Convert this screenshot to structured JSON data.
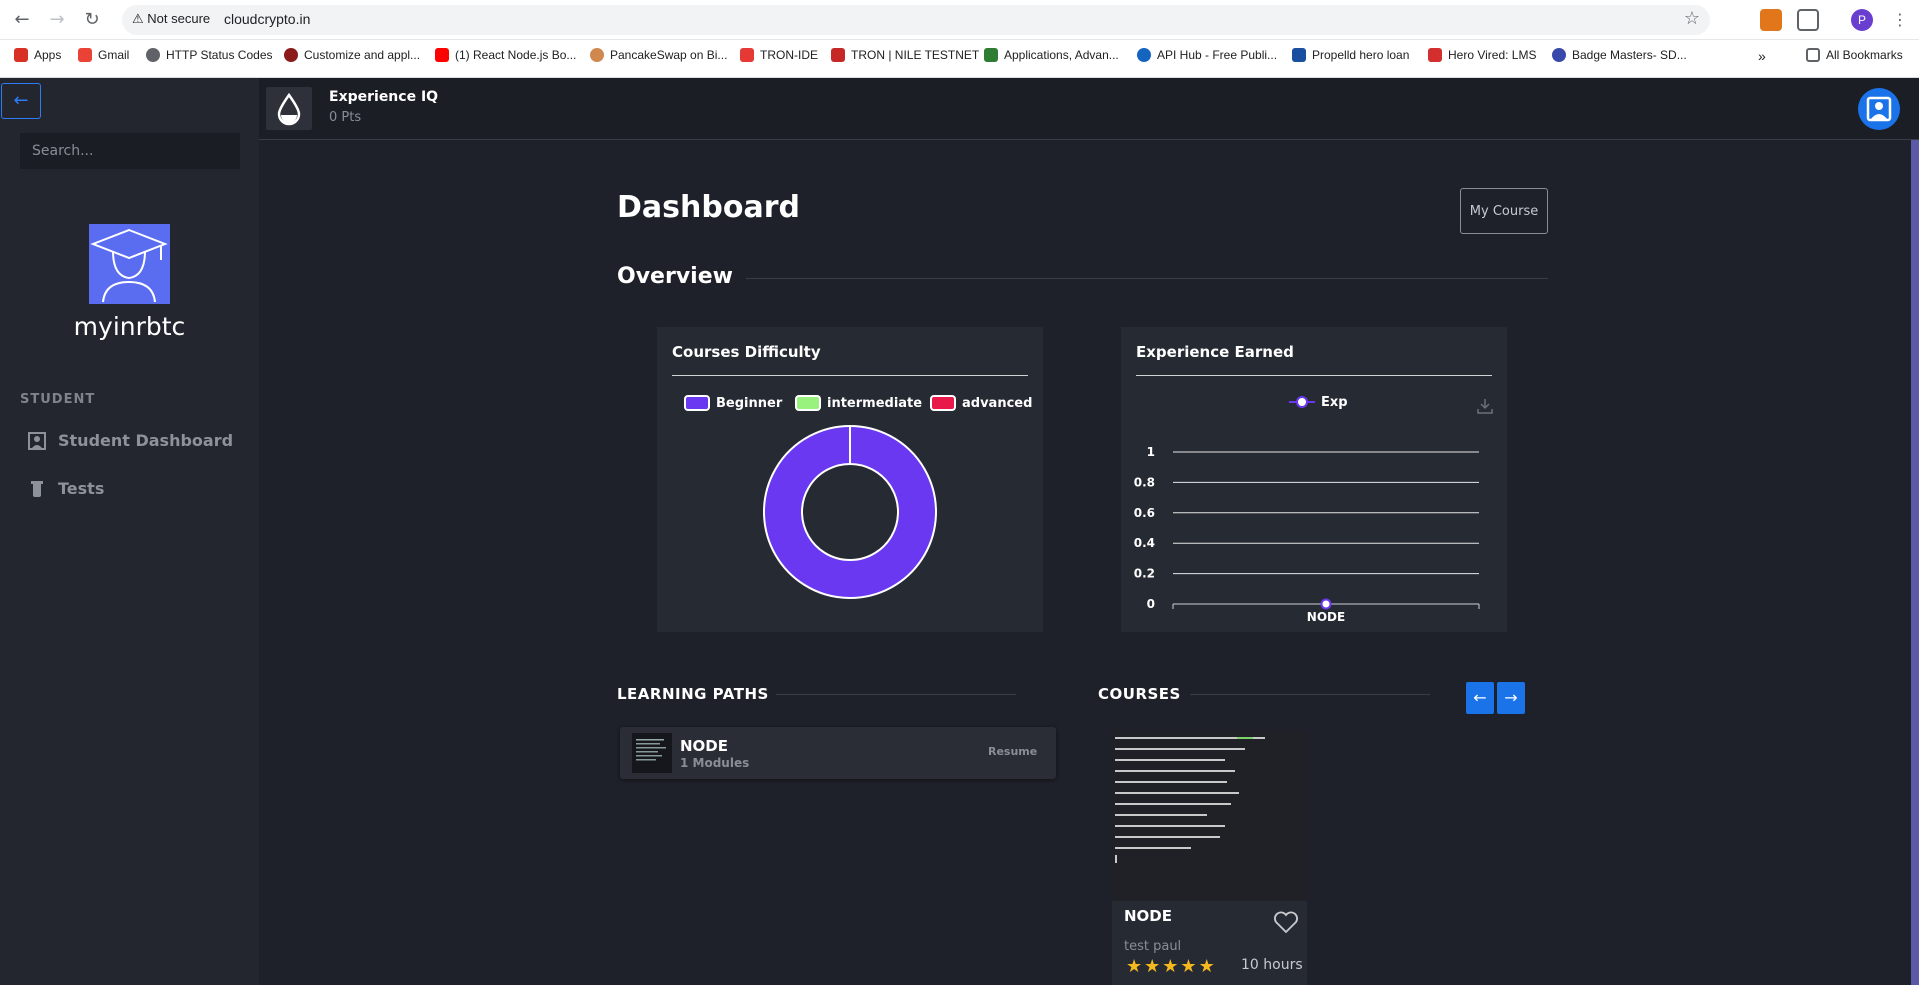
{
  "browser": {
    "not_secure": "Not secure",
    "url": "cloudcrypto.in",
    "profile_initial": "P",
    "all_bookmarks": "All Bookmarks",
    "bookmarks": [
      "Apps",
      "Gmail",
      "HTTP Status Codes",
      "Customize and appl...",
      "(1) React Node.js Bo...",
      "PancakeSwap on Bi...",
      "TRON-IDE",
      "TRON | NILE TESTNET",
      "Applications, Advan...",
      "API Hub - Free Publi...",
      "Propelld hero loan",
      "Hero Vired: LMS",
      "Badge Masters- SD..."
    ]
  },
  "sidebar": {
    "search_placeholder": "Search...",
    "username": "myinrbtc",
    "section": "STUDENT",
    "items": [
      {
        "label": "Student Dashboard",
        "icon": "user-square-icon"
      },
      {
        "label": "Tests",
        "icon": "test-tube-icon"
      }
    ]
  },
  "topbar": {
    "title": "Experience IQ",
    "points": "0 Pts"
  },
  "main": {
    "title": "Dashboard",
    "my_course_button": "My Course",
    "overview": "Overview",
    "learning_paths_heading": "LEARNING PATHS",
    "courses_heading": "COURSES"
  },
  "charts": {
    "difficulty_title": "Courses Difficulty",
    "experience_title": "Experience Earned"
  },
  "chart_data": [
    {
      "type": "pie",
      "title": "Courses Difficulty",
      "categories": [
        "Beginner",
        "intermediate",
        "advanced"
      ],
      "values": [
        1,
        0,
        0
      ],
      "colors": [
        "#6a38f0",
        "#9af27e",
        "#e8194a"
      ],
      "legend": "top"
    },
    {
      "type": "line",
      "title": "Experience Earned",
      "categories": [
        "NODE"
      ],
      "series": [
        {
          "name": "Exp",
          "values": [
            0
          ]
        }
      ],
      "yticks": [
        "1",
        "0.8",
        "0.6",
        "0.4",
        "0.2",
        "0"
      ],
      "ylim": [
        0,
        1
      ],
      "grid": true,
      "legend": "top"
    }
  ],
  "learning_path": {
    "title": "NODE",
    "modules": "1 Modules",
    "action": "Resume"
  },
  "course": {
    "title": "NODE",
    "author": "test paul",
    "rating": 5,
    "duration": "10 hours"
  },
  "colors": {
    "accent": "#1a73e8",
    "beginner": "#6a38f0",
    "background": "#1e2129"
  }
}
